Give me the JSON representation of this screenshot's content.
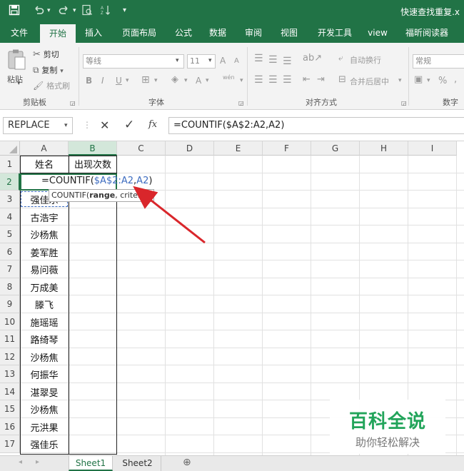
{
  "window": {
    "title": "快速查找重复.x"
  },
  "qat": {
    "save_icon": "save-icon",
    "undo_icon": "undo-icon",
    "redo_icon": "redo-icon",
    "preview_icon": "print-preview-icon",
    "sort_icon": "sort-icon",
    "more": "▾"
  },
  "tabs": [
    "文件",
    "开始",
    "插入",
    "页面布局",
    "公式",
    "数据",
    "审阅",
    "视图",
    "开发工具",
    "view",
    "福昕阅读器"
  ],
  "ribbon": {
    "clipboard": {
      "paste": "粘贴",
      "cut": "剪切",
      "copy": "复制",
      "format_painter": "格式刷",
      "group_label": "剪贴板"
    },
    "font": {
      "font_name": "等线",
      "font_size": "11",
      "bold": "B",
      "italic": "I",
      "underline": "U",
      "grow": "A",
      "shrink": "A",
      "phonetic": "wén",
      "group_label": "字体"
    },
    "alignment": {
      "wrap": "自动换行",
      "merge": "合并后居中",
      "group_label": "对齐方式"
    },
    "number": {
      "format": "常规",
      "percent": "%",
      "comma": ",",
      "group_label": "数字"
    }
  },
  "formula_bar": {
    "name_box": "REPLACE",
    "cancel": "✕",
    "enter": "✓",
    "fx": "fx",
    "formula": "=COUNTIF($A$2:A2,A2)"
  },
  "columns": [
    "A",
    "B",
    "C",
    "D",
    "E",
    "F",
    "G",
    "H",
    "I"
  ],
  "rows": [
    "1",
    "2",
    "3",
    "4",
    "5",
    "6",
    "7",
    "8",
    "9",
    "10",
    "11",
    "12",
    "13",
    "14",
    "15",
    "16",
    "17"
  ],
  "cells": {
    "A1": "姓名",
    "B1": "出现次数",
    "A2_edit": {
      "prefix": "=COUNTIF(",
      "range": "$A$2:A2",
      "comma": ",",
      "crit": "A2",
      "suffix": ")"
    },
    "names": [
      "强佳乐",
      "古浩宇",
      "沙杨焦",
      "姜军胜",
      "易问薇",
      "万成美",
      "滕飞",
      "施瑶瑶",
      "路绮琴",
      "沙杨焦",
      "何振华",
      "湛翠旻",
      "沙杨焦",
      "元洪果",
      "强佳乐"
    ]
  },
  "tooltip": {
    "fn": "COUNTIF(",
    "arg1": "range",
    "rest": ", criteria)"
  },
  "sheets": [
    "Sheet1",
    "Sheet2"
  ],
  "watermark": {
    "title": "百科全说",
    "subtitle": "助你轻松解决"
  },
  "colors": {
    "brand": "#217346",
    "arrow": "#d9262b",
    "range_ref": "#3d6cc0",
    "crit_ref": "#c0392b"
  }
}
